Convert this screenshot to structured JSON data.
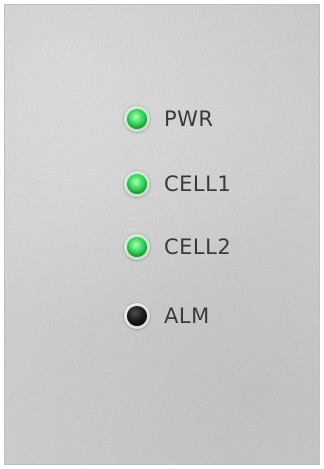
{
  "indicators": [
    {
      "label": "PWR",
      "state": "on",
      "color": "#3fd15f"
    },
    {
      "label": "CELL1",
      "state": "on",
      "color": "#3fd15f"
    },
    {
      "label": "CELL2",
      "state": "on",
      "color": "#3fd15f"
    },
    {
      "label": "ALM",
      "state": "off",
      "color": "#111111"
    }
  ],
  "panel_color": "#d6d6d6"
}
